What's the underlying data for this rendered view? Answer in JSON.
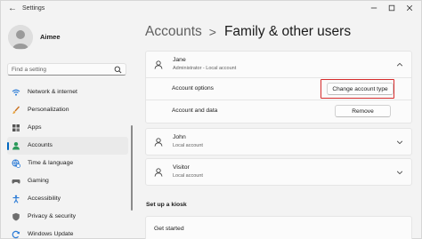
{
  "window": {
    "title": "Settings"
  },
  "user": {
    "name": "Aimee"
  },
  "search": {
    "placeholder": "Find a setting"
  },
  "sidebar": {
    "items": [
      {
        "label": "Network & internet",
        "icon": "wifi-icon",
        "active": false
      },
      {
        "label": "Personalization",
        "icon": "brush-icon",
        "active": false
      },
      {
        "label": "Apps",
        "icon": "apps-icon",
        "active": false
      },
      {
        "label": "Accounts",
        "icon": "accounts-icon",
        "active": true
      },
      {
        "label": "Time & language",
        "icon": "globe-clock-icon",
        "active": false
      },
      {
        "label": "Gaming",
        "icon": "gamepad-icon",
        "active": false
      },
      {
        "label": "Accessibility",
        "icon": "accessibility-icon",
        "active": false
      },
      {
        "label": "Privacy & security",
        "icon": "shield-icon",
        "active": false
      },
      {
        "label": "Windows Update",
        "icon": "update-icon",
        "active": false
      }
    ]
  },
  "breadcrumb": {
    "parent": "Accounts",
    "separator": ">",
    "current": "Family & other users"
  },
  "users": [
    {
      "name": "Jane",
      "role": "Administrator - Local account",
      "expanded": true
    },
    {
      "name": "John",
      "role": "Local account",
      "expanded": false
    },
    {
      "name": "Visitor",
      "role": "Local account",
      "expanded": false
    }
  ],
  "jane_options": {
    "account_options_label": "Account options",
    "change_button": "Change account type",
    "account_data_label": "Account and data",
    "remove_button": "Remove"
  },
  "kiosk": {
    "section_title": "Set up a kiosk",
    "get_started": "Get started"
  },
  "colors": {
    "accent": "#0067c0",
    "highlight_box": "#d62b2b"
  }
}
